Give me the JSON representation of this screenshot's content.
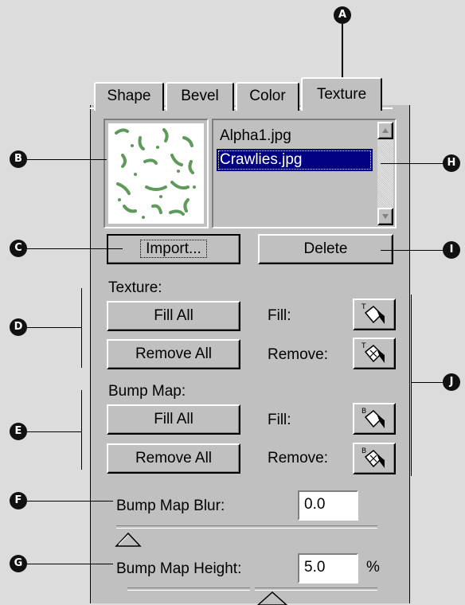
{
  "tabs": [
    "Shape",
    "Bevel",
    "Color",
    "Texture"
  ],
  "active_tab": "Texture",
  "texture_list": {
    "items": [
      "Alpha1.jpg",
      "Crawlies.jpg"
    ],
    "selected": "Crawlies.jpg"
  },
  "buttons": {
    "import": "Import...",
    "delete": "Delete"
  },
  "texture_section": {
    "label": "Texture:",
    "fill_all": "Fill All",
    "remove_all": "Remove All",
    "fill_label": "Fill:",
    "remove_label": "Remove:"
  },
  "bump_section": {
    "label": "Bump Map:",
    "fill_all": "Fill All",
    "remove_all": "Remove All",
    "fill_label": "Fill:",
    "remove_label": "Remove:"
  },
  "bump_blur": {
    "label": "Bump Map Blur:",
    "value": "0.0"
  },
  "bump_height": {
    "label": "Bump Map Height:",
    "value": "5.0",
    "unit": "%"
  },
  "callouts": [
    "A",
    "B",
    "C",
    "D",
    "E",
    "F",
    "G",
    "H",
    "I",
    "J"
  ],
  "colors": {
    "panel": "#c0c0c0",
    "selection": "#000080",
    "texture_green": "#5f9a5a"
  },
  "icons": [
    "texture-fill-icon",
    "texture-remove-icon",
    "bump-fill-icon",
    "bump-remove-icon",
    "scroll-up-icon",
    "scroll-down-icon"
  ]
}
